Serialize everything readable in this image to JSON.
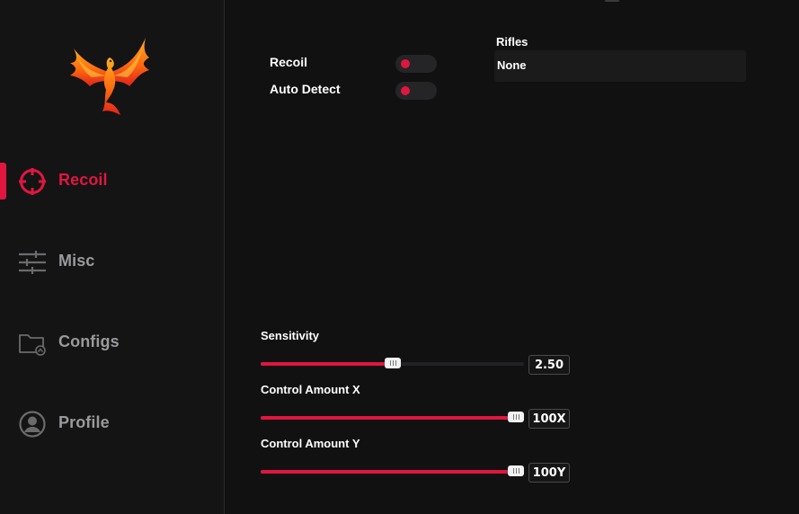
{
  "theme": {
    "accent": "#e0163f",
    "muted": "#9a9a9c",
    "sidebar_bg": "#141415",
    "main_bg": "#111112"
  },
  "sidebar": {
    "logo_icon": "phoenix-logo",
    "items": [
      {
        "label": "Recoil",
        "icon": "crosshair-icon",
        "active": true
      },
      {
        "label": "Misc",
        "icon": "sliders-icon",
        "active": false
      },
      {
        "label": "Configs",
        "icon": "folder-icon",
        "active": false
      },
      {
        "label": "Profile",
        "icon": "user-icon",
        "active": false
      }
    ]
  },
  "recoil": {
    "toggles": [
      {
        "label": "Recoil",
        "state": "off"
      },
      {
        "label": "Auto Detect",
        "state": "off"
      }
    ],
    "weapon_select": {
      "label": "Rifles",
      "value": "None"
    },
    "sliders": [
      {
        "label": "Sensitivity",
        "value_text": "2.50",
        "fraction": 0.5
      },
      {
        "label": "Control Amount X",
        "value_text": "100X",
        "fraction": 1.0
      },
      {
        "label": "Control Amount Y",
        "value_text": "100Y",
        "fraction": 1.0
      }
    ]
  }
}
